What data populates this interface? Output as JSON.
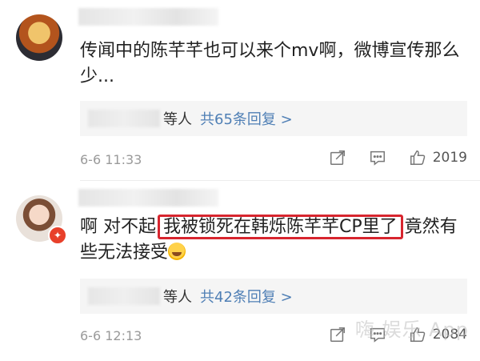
{
  "comments": [
    {
      "text": "传闻中的陈芊芊也可以来个mv啊，微博宣传那么少...",
      "reply_suffix": "等人",
      "reply_link": "共65条回复 >",
      "time": "6-6 11:33",
      "likes": "2019",
      "icons": [
        "share-icon",
        "comment-icon",
        "like-icon"
      ]
    },
    {
      "text_before": "啊 对不起",
      "text_highlight": "我被锁死在韩烁陈芊芊CP里了",
      "text_after": "竟然有些无法接受",
      "reply_suffix": "等人",
      "reply_link": "共42条回复 >",
      "time": "6-6 12:13",
      "likes": "2084",
      "verified_badge": "✦"
    }
  ],
  "colors": {
    "highlight_border": "#d7252e",
    "link": "#4f7fb5",
    "meta": "#9a9a9a",
    "reply_bg": "#f5f5f5"
  },
  "watermark": "嗨 娱乐 App"
}
